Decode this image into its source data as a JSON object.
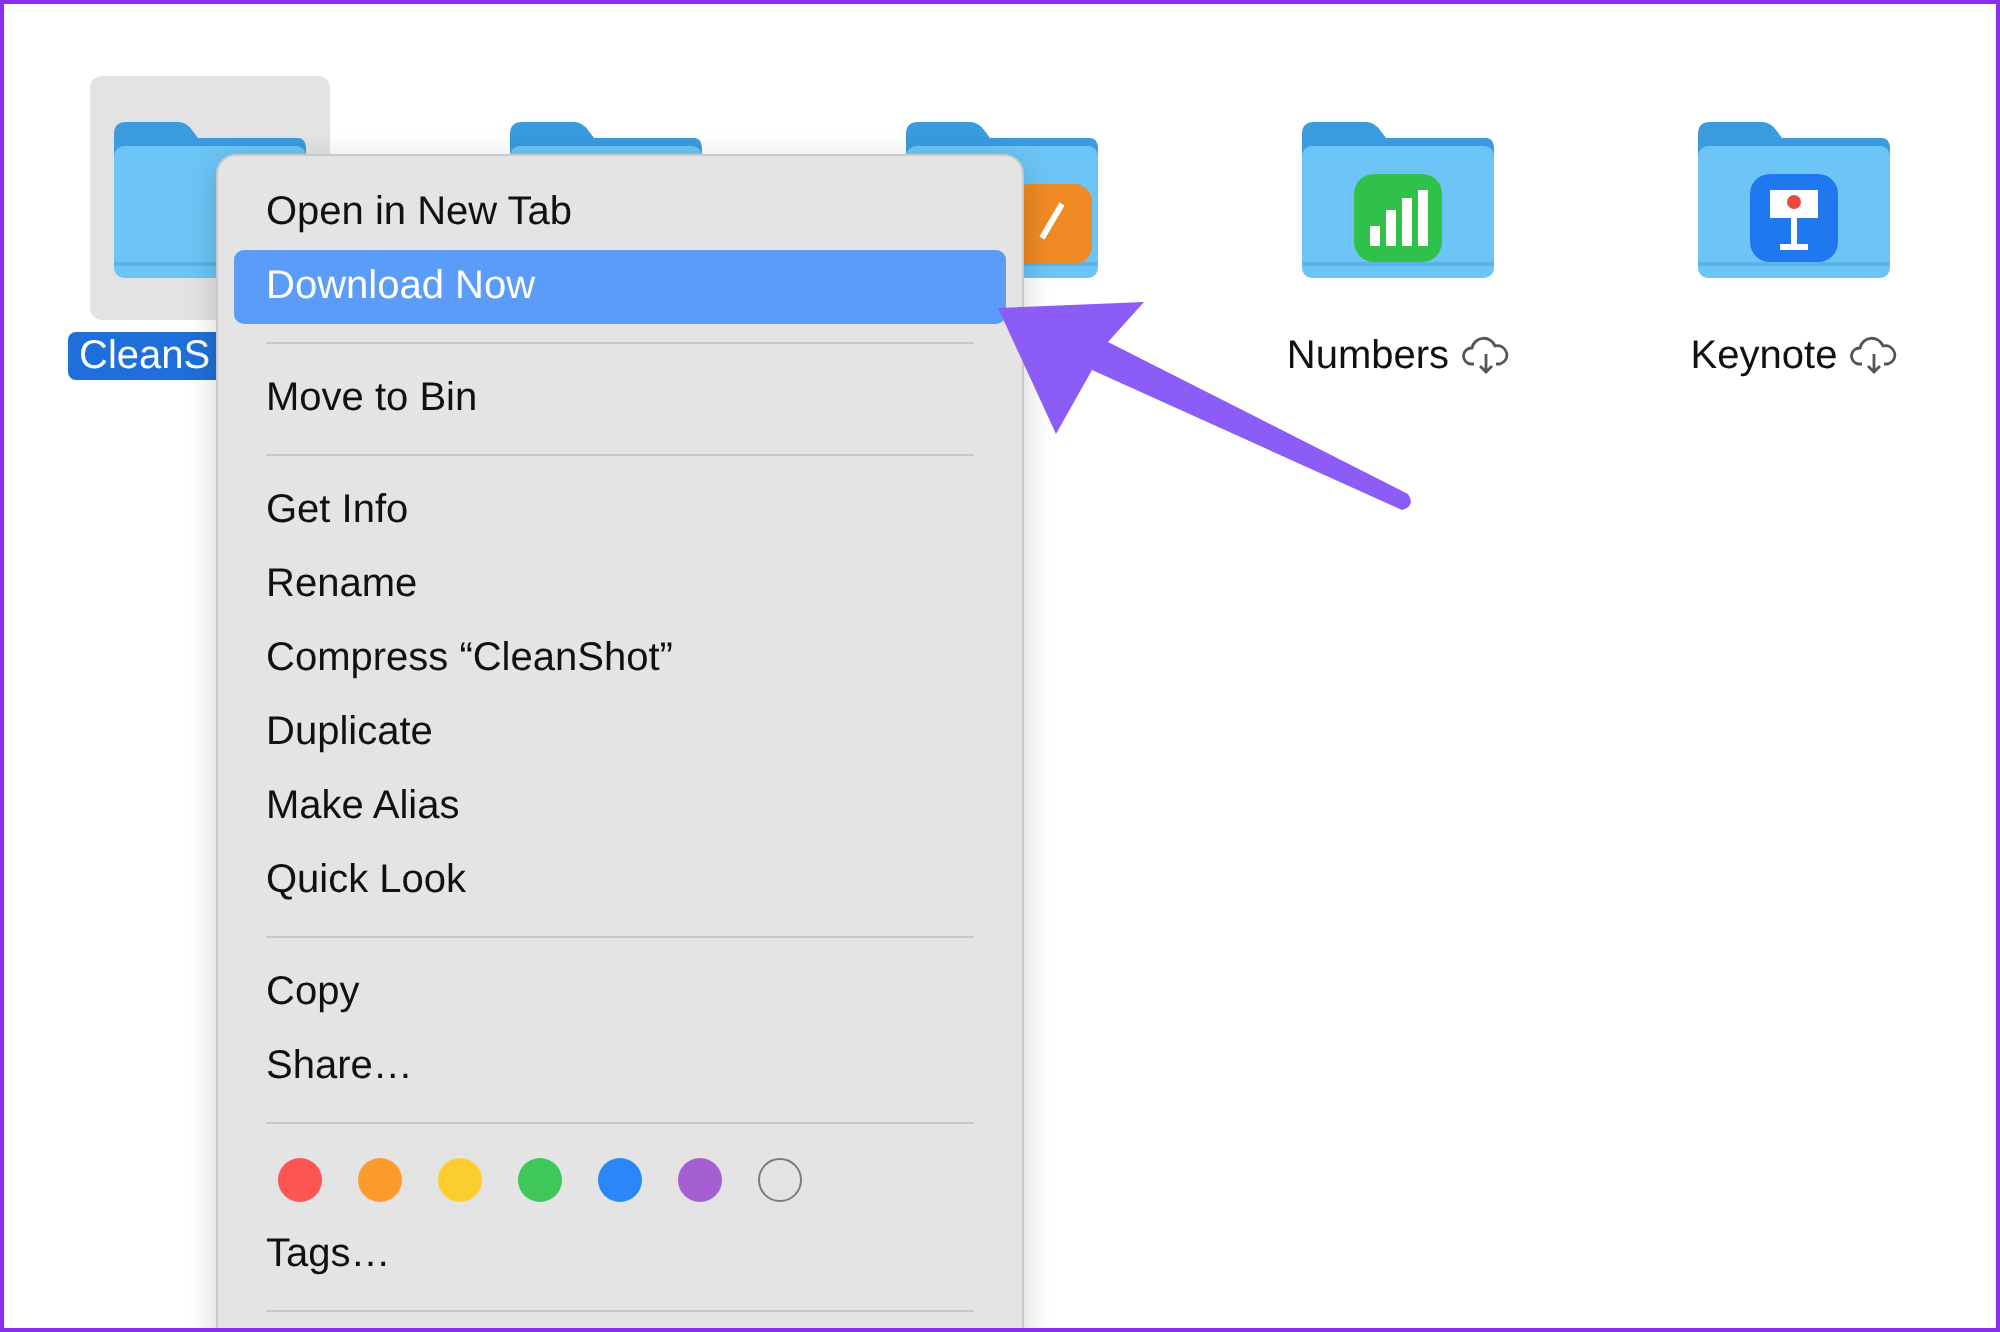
{
  "folders": [
    {
      "kind": "plain",
      "label": "CleanS",
      "selected": true
    },
    {
      "kind": "plain",
      "selected": false
    },
    {
      "kind": "orange-app",
      "selected": false
    },
    {
      "kind": "chart-app",
      "label": "Numbers",
      "selected": false,
      "cloud": true
    },
    {
      "kind": "lectern-app",
      "label": "Keynote",
      "selected": false,
      "cloud": true
    }
  ],
  "context_menu": {
    "sections": [
      {
        "items": [
          {
            "label": "Open in New Tab",
            "selected": false
          },
          {
            "label": "Download Now",
            "selected": true
          }
        ]
      },
      {
        "items": [
          {
            "label": "Move to Bin",
            "selected": false
          }
        ]
      },
      {
        "items": [
          {
            "label": "Get Info",
            "selected": false
          },
          {
            "label": "Rename",
            "selected": false
          },
          {
            "label": "Compress “CleanShot”",
            "selected": false
          },
          {
            "label": "Duplicate",
            "selected": false
          },
          {
            "label": "Make Alias",
            "selected": false
          },
          {
            "label": "Quick Look",
            "selected": false
          }
        ]
      },
      {
        "items": [
          {
            "label": "Copy",
            "selected": false
          },
          {
            "label": "Share…",
            "selected": false
          }
        ]
      },
      {
        "tags": [
          {
            "color": "#fd5552",
            "outline": false
          },
          {
            "color": "#fb9b2c",
            "outline": false
          },
          {
            "color": "#fccd2e",
            "outline": false
          },
          {
            "color": "#3fc759",
            "outline": false
          },
          {
            "color": "#2b87f7",
            "outline": false
          },
          {
            "color": "#a65ed3",
            "outline": false
          },
          {
            "color": "#7a7a7a",
            "outline": true
          }
        ],
        "items": [
          {
            "label": "Tags…",
            "selected": false
          }
        ]
      }
    ]
  }
}
